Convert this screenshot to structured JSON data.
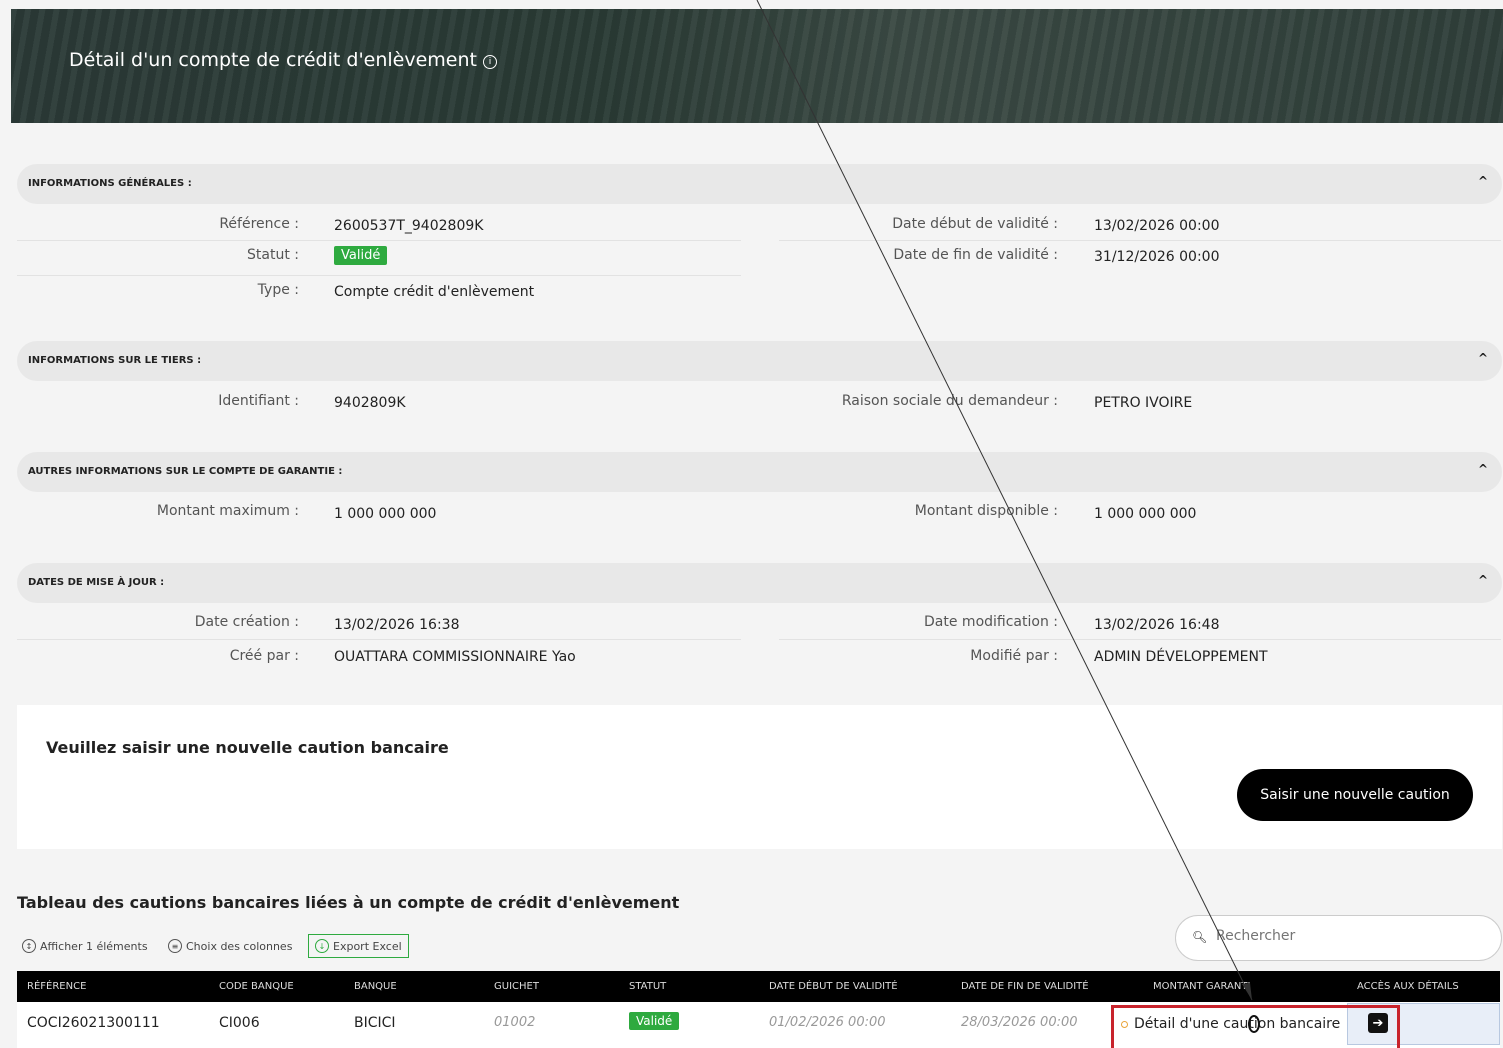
{
  "header": {
    "title": "Détail d'un compte de crédit d'enlèvement"
  },
  "sections": {
    "general": {
      "title": "INFORMATIONS GÉNÉRALES :",
      "reference_label": "Référence :",
      "reference": "2600537T_9402809K",
      "statut_label": "Statut :",
      "statut": "Validé",
      "type_label": "Type :",
      "type": "Compte crédit d'enlèvement",
      "date_debut_label": "Date début de validité :",
      "date_debut": "13/02/2026 00:00",
      "date_fin_label": "Date de fin de validité :",
      "date_fin": "31/12/2026 00:00"
    },
    "tiers": {
      "title": "INFORMATIONS SUR LE TIERS :",
      "identifiant_label": "Identifiant :",
      "identifiant": "9402809K",
      "raison_label": "Raison sociale du demandeur :",
      "raison": "PETRO IVOIRE"
    },
    "garantie": {
      "title": "AUTRES INFORMATIONS SUR LE COMPTE DE GARANTIE :",
      "max_label": "Montant maximum :",
      "max": "1 000 000 000",
      "dispo_label": "Montant disponible :",
      "dispo": "1 000 000 000"
    },
    "maj": {
      "title": "DATES DE MISE À JOUR :",
      "creation_label": "Date création :",
      "creation": "13/02/2026 16:38",
      "modif_label": "Date modification :",
      "modif": "13/02/2026 16:48",
      "cree_par_label": "Créé par :",
      "cree_par": "OUATTARA COMMISSIONNAIRE Yao",
      "modifie_par_label": "Modifié par :",
      "modifie_par": "ADMIN DÉVELOPPEMENT"
    }
  },
  "new_caution": {
    "title": "Veuillez saisir une nouvelle caution bancaire",
    "button": "Saisir une nouvelle caution"
  },
  "table": {
    "title": "Tableau des cautions bancaires liées à un compte de crédit d'enlèvement",
    "toolbar": {
      "show": "Afficher 1 éléments",
      "columns": "Choix des colonnes",
      "export": "Export Excel"
    },
    "search_placeholder": "Rechercher",
    "headers": [
      "RÉFÉRENCE",
      "CODE BANQUE",
      "BANQUE",
      "GUICHET",
      "STATUT",
      "DATE DÉBUT DE VALIDITÉ",
      "DATE DE FIN DE VALIDITÉ",
      "MONTANT GARANTI",
      "ACCÈS AUX DÉTAILS"
    ],
    "rows": [
      {
        "reference": "COCI26021300111",
        "code_banque": "CI006",
        "banque": "BICICI",
        "guichet": "01002",
        "statut": "Validé",
        "date_debut": "01/02/2026 00:00",
        "date_fin": "28/03/2026 00:00"
      }
    ],
    "context_item": "Détail d'une caution bancaire"
  },
  "icons": {
    "info": "info-icon",
    "chevron": "chevron-up-icon",
    "search": "search-icon",
    "arrow": "arrow-right-icon"
  },
  "colors": {
    "badge": "#2eaa3f",
    "highlight": "#c8232c"
  }
}
